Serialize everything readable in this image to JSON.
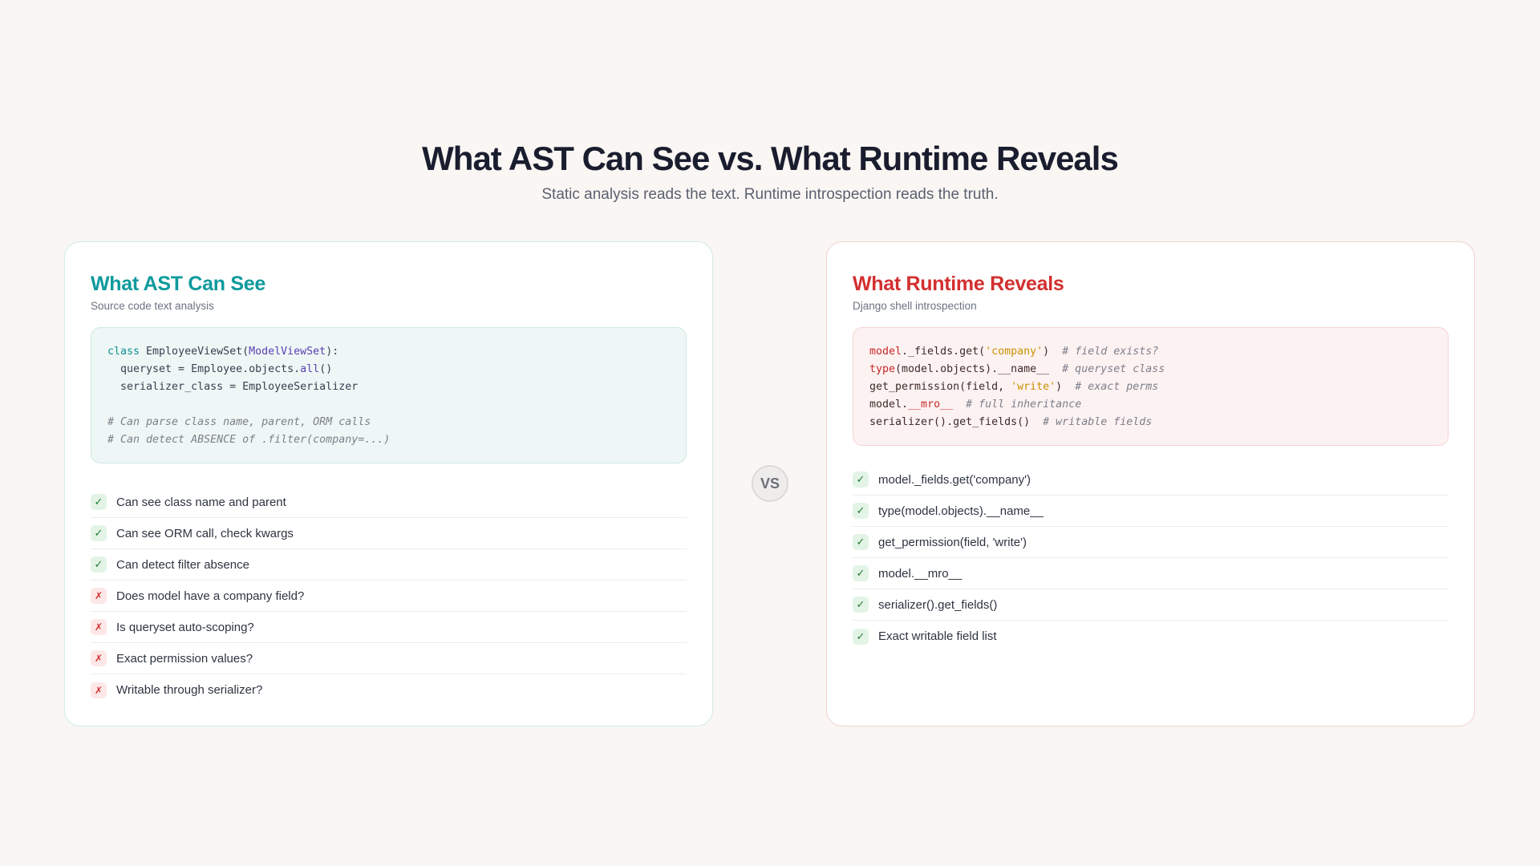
{
  "header": {
    "title": "What AST Can See vs. What Runtime Reveals",
    "subtitle": "Static analysis reads the text. Runtime introspection reads the truth."
  },
  "left": {
    "title": "What AST Can See",
    "subtitle": "Source code text analysis",
    "code": {
      "l1_kw": "class",
      "l1_a": " EmployeeViewSet(",
      "l1_parent": "ModelViewSet",
      "l1_b": "):",
      "l2_a": "  queryset = Employee.objects.",
      "l2_call": "all",
      "l2_b": "()",
      "l3": "  serializer_class = EmployeeSerializer",
      "c1": "# Can parse class name, parent, ORM calls",
      "c2": "# Can detect ABSENCE of .filter(company=...)"
    },
    "items": [
      {
        "status": "check",
        "icon": "✓",
        "label": "Can see class name and parent"
      },
      {
        "status": "check",
        "icon": "✓",
        "label": "Can see ORM call, check kwargs"
      },
      {
        "status": "check",
        "icon": "✓",
        "label": "Can detect filter absence"
      },
      {
        "status": "cross",
        "icon": "✗",
        "label": "Does model have a company field?"
      },
      {
        "status": "cross",
        "icon": "✗",
        "label": "Is queryset auto-scoping?"
      },
      {
        "status": "cross",
        "icon": "✗",
        "label": "Exact permission values?"
      },
      {
        "status": "cross",
        "icon": "✗",
        "label": "Writable through serializer?"
      }
    ]
  },
  "vs_label": "VS",
  "right": {
    "title": "What Runtime Reveals",
    "subtitle": "Django shell introspection",
    "code": {
      "l1_a": "model",
      "l1_b": "._fields.get(",
      "l1_str": "'company'",
      "l1_c": ")  ",
      "l1_cmt": "# field exists?",
      "l2_a": "type",
      "l2_b": "(model.objects).__name__  ",
      "l2_cmt": "# queryset class",
      "l3_a": "get_permission(field, ",
      "l3_str": "'write'",
      "l3_b": ")  ",
      "l3_cmt": "# exact perms",
      "l4_a": "model.",
      "l4_b": "__mro__",
      "l4_c": "  ",
      "l4_cmt": "# full inheritance",
      "l5_a": "serializer().get_fields()  ",
      "l5_cmt": "# writable fields"
    },
    "items": [
      {
        "status": "check",
        "icon": "✓",
        "label": "model._fields.get('company')"
      },
      {
        "status": "check",
        "icon": "✓",
        "label": "type(model.objects).__name__"
      },
      {
        "status": "check",
        "icon": "✓",
        "label": "get_permission(field, 'write')"
      },
      {
        "status": "check",
        "icon": "✓",
        "label": "model.__mro__"
      },
      {
        "status": "check",
        "icon": "✓",
        "label": "serializer().get_fields()"
      },
      {
        "status": "check",
        "icon": "✓",
        "label": "Exact writable field list"
      }
    ]
  },
  "colors": {
    "ast_accent": "#0e9a9c",
    "runtime_accent": "#d32f2f",
    "check_green": "#1e7b34",
    "cross_red": "#d32f2f"
  }
}
